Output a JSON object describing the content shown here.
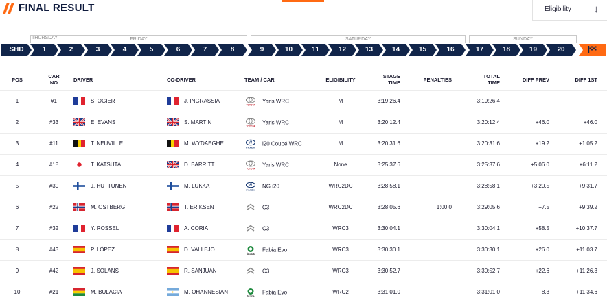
{
  "header": {
    "title": "FINAL RESULT",
    "eligibility_label": "Eligibility",
    "dropdown_icon": "arrow-down-icon",
    "accent_color": "#ff6a13",
    "navy_color": "#11254a"
  },
  "days": {
    "thursday": "THURSDAY",
    "friday": "FRIDAY",
    "saturday": "SATURDAY",
    "sunday": "SUNDAY"
  },
  "stages": [
    "SHD",
    "1",
    "2",
    "3",
    "4",
    "5",
    "6",
    "7",
    "8",
    "9",
    "10",
    "11",
    "12",
    "13",
    "14",
    "15",
    "16",
    "17",
    "18",
    "19",
    "20"
  ],
  "stage_end_icon": "finish-flag-icon",
  "columns": {
    "pos": "POS",
    "car_no_1": "CAR",
    "car_no_2": "NO",
    "driver": "DRIVER",
    "co_driver": "CO-DRIVER",
    "team_car": "TEAM / CAR",
    "eligibility": "ELIGIBILITY",
    "stage_1": "STAGE",
    "stage_2": "TIME",
    "penalties": "PENALTIES",
    "total_1": "TOTAL",
    "total_2": "TIME",
    "diff_prev": "DIFF PREV",
    "diff_1st": "DIFF 1ST"
  },
  "rows": [
    {
      "pos": "1",
      "car": "#1",
      "driver_flag": "fr",
      "driver": "S. OGIER",
      "co_flag": "fr",
      "co": "J. INGRASSIA",
      "brand": "toyota",
      "car_model": "Yaris WRC",
      "elig": "M",
      "stage": "3:19:26.4",
      "pen": "",
      "total": "3:19:26.4",
      "diff_prev": "",
      "diff_1st": ""
    },
    {
      "pos": "2",
      "car": "#33",
      "driver_flag": "gb",
      "driver": "E. EVANS",
      "co_flag": "gb",
      "co": "S. MARTIN",
      "brand": "toyota",
      "car_model": "Yaris WRC",
      "elig": "M",
      "stage": "3:20:12.4",
      "pen": "",
      "total": "3:20:12.4",
      "diff_prev": "+46.0",
      "diff_1st": "+46.0"
    },
    {
      "pos": "3",
      "car": "#11",
      "driver_flag": "be",
      "driver": "T. NEUVILLE",
      "co_flag": "be",
      "co": "M. WYDAEGHE",
      "brand": "hyundai",
      "car_model": "i20 Coupé WRC",
      "elig": "M",
      "stage": "3:20:31.6",
      "pen": "",
      "total": "3:20:31.6",
      "diff_prev": "+19.2",
      "diff_1st": "+1:05.2"
    },
    {
      "pos": "4",
      "car": "#18",
      "driver_flag": "jp",
      "driver": "T. KATSUTA",
      "co_flag": "gb",
      "co": "D. BARRITT",
      "brand": "toyota",
      "car_model": "Yaris WRC",
      "elig": "None",
      "stage": "3:25:37.6",
      "pen": "",
      "total": "3:25:37.6",
      "diff_prev": "+5:06.0",
      "diff_1st": "+6:11.2"
    },
    {
      "pos": "5",
      "car": "#30",
      "driver_flag": "fi",
      "driver": "J. HUTTUNEN",
      "co_flag": "fi",
      "co": "M. LUKKA",
      "brand": "hyundai",
      "car_model": "NG i20",
      "elig": "WRC2DC",
      "stage": "3:28:58.1",
      "pen": "",
      "total": "3:28:58.1",
      "diff_prev": "+3:20.5",
      "diff_1st": "+9:31.7"
    },
    {
      "pos": "6",
      "car": "#22",
      "driver_flag": "no",
      "driver": "M. OSTBERG",
      "co_flag": "no",
      "co": "T. ERIKSEN",
      "brand": "citroen",
      "car_model": "C3",
      "elig": "WRC2DC",
      "stage": "3:28:05.6",
      "pen": "1:00.0",
      "total": "3:29:05.6",
      "diff_prev": "+7.5",
      "diff_1st": "+9:39.2"
    },
    {
      "pos": "7",
      "car": "#32",
      "driver_flag": "fr",
      "driver": "Y. ROSSEL",
      "co_flag": "fr",
      "co": "A. CORIA",
      "brand": "citroen",
      "car_model": "C3",
      "elig": "WRC3",
      "stage": "3:30:04.1",
      "pen": "",
      "total": "3:30:04.1",
      "diff_prev": "+58.5",
      "diff_1st": "+10:37.7"
    },
    {
      "pos": "8",
      "car": "#43",
      "driver_flag": "es",
      "driver": "P. LÓPEZ",
      "co_flag": "es",
      "co": "D. VALLEJO",
      "brand": "skoda",
      "car_model": "Fabia Evo",
      "elig": "WRC3",
      "stage": "3:30:30.1",
      "pen": "",
      "total": "3:30:30.1",
      "diff_prev": "+26.0",
      "diff_1st": "+11:03.7"
    },
    {
      "pos": "9",
      "car": "#42",
      "driver_flag": "es",
      "driver": "J. SOLANS",
      "co_flag": "es",
      "co": "R. SANJUAN",
      "brand": "citroen",
      "car_model": "C3",
      "elig": "WRC3",
      "stage": "3:30:52.7",
      "pen": "",
      "total": "3:30:52.7",
      "diff_prev": "+22.6",
      "diff_1st": "+11:26.3"
    },
    {
      "pos": "10",
      "car": "#21",
      "driver_flag": "bo",
      "driver": "M. BULACIA",
      "co_flag": "ar",
      "co": "M. OHANNESIAN",
      "brand": "skoda",
      "car_model": "Fabia Evo",
      "elig": "WRC2",
      "stage": "3:31:01.0",
      "pen": "",
      "total": "3:31:01.0",
      "diff_prev": "+8.3",
      "diff_1st": "+11:34.6"
    }
  ]
}
